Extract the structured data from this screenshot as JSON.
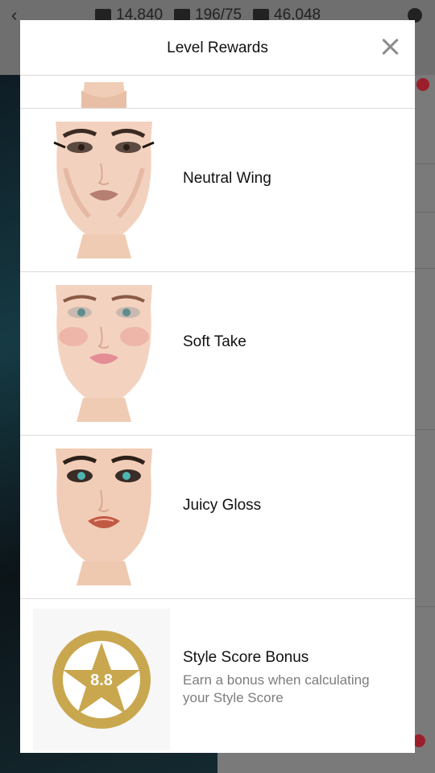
{
  "background": {
    "stats": [
      "14,840",
      "196/75",
      "46,048"
    ]
  },
  "modal": {
    "title": "Level Rewards"
  },
  "rewards": [
    {
      "label": ""
    },
    {
      "label": "Neutral Wing"
    },
    {
      "label": "Soft Take"
    },
    {
      "label": "Juicy Gloss"
    }
  ],
  "bonus": {
    "title": "Style Score Bonus",
    "description": "Earn a bonus when calculating your Style Score",
    "score": "8.8"
  },
  "colors": {
    "badge_gold": "#c9a74f",
    "accent_red": "#9b1f2a"
  }
}
